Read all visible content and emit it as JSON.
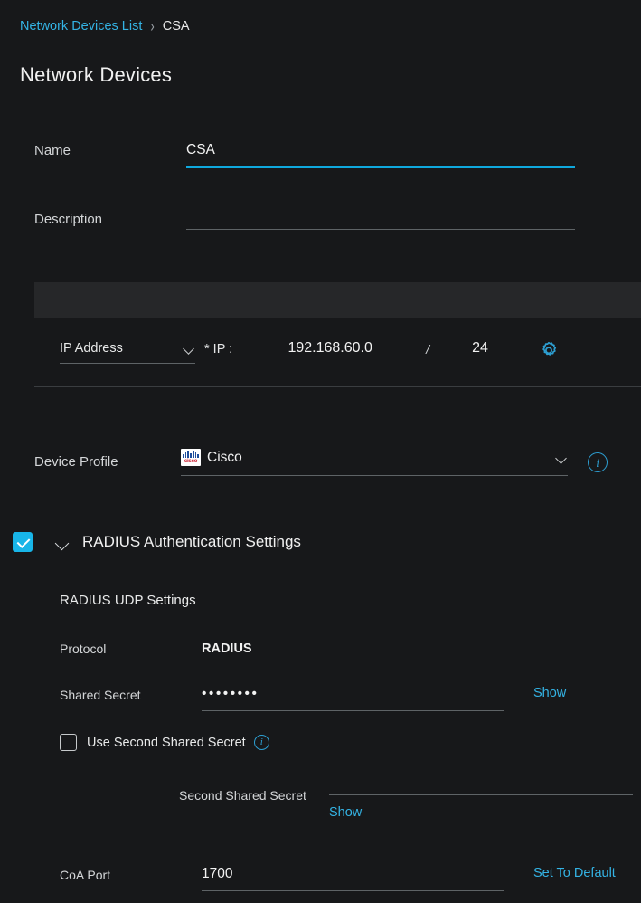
{
  "breadcrumb": {
    "parent": "Network Devices List",
    "separator": "›",
    "current": "CSA"
  },
  "page_title": "Network Devices",
  "form": {
    "name": {
      "label": "Name",
      "value": "CSA"
    },
    "description": {
      "label": "Description",
      "value": ""
    }
  },
  "ip_table": {
    "type_select": {
      "value": "IP Address"
    },
    "ip_label": "* IP :",
    "ip_value": "192.168.60.0",
    "slash": "/",
    "mask_value": "24",
    "settings_icon": "gear-icon"
  },
  "device_profile": {
    "label": "Device Profile",
    "value": "Cisco",
    "logo_text": "cisco",
    "info_icon": "info-icon"
  },
  "radius_section": {
    "title": "RADIUS Authentication Settings",
    "checked": true,
    "sub_title": "RADIUS UDP Settings",
    "protocol": {
      "label": "Protocol",
      "value": "RADIUS"
    },
    "shared_secret": {
      "label": "Shared Secret",
      "value": "••••••••",
      "show_label": "Show"
    },
    "use_second_shared_secret": {
      "label": "Use Second Shared Secret",
      "checked": false,
      "info_icon": "info-icon"
    },
    "second_shared_secret": {
      "label": "Second Shared Secret",
      "value": "",
      "show_label": "Show"
    },
    "coa_port": {
      "label": "CoA Port",
      "value": "1700",
      "action_label": "Set To Default"
    }
  },
  "colors": {
    "background": "#17181a",
    "accent": "#34b3e4",
    "active_underline": "#0fa8dd",
    "checkbox_checked": "#18b5e8",
    "text": "#e8e8e8",
    "rule": "#5e6366"
  }
}
